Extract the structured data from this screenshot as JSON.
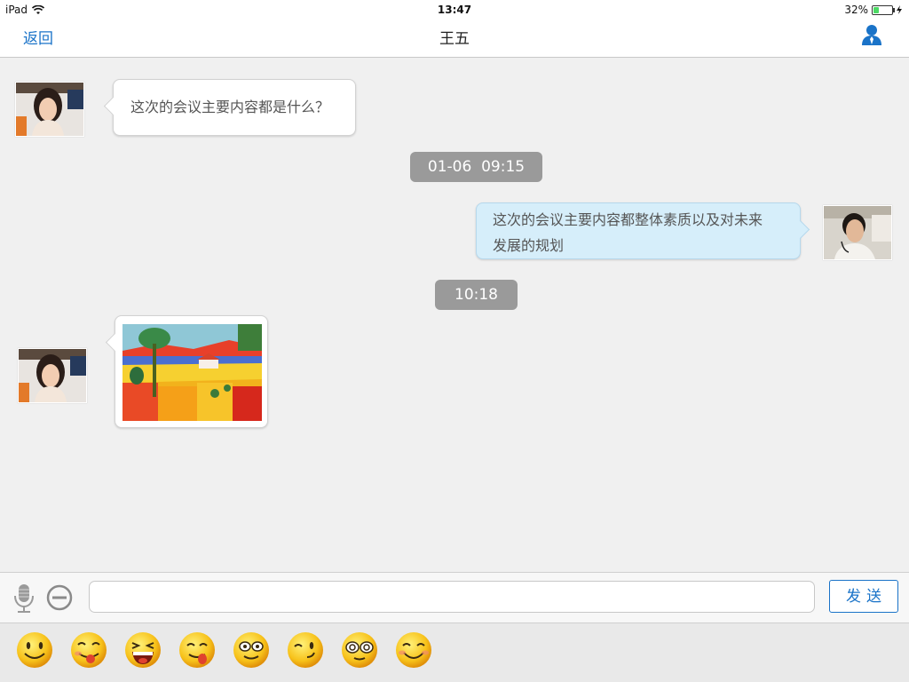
{
  "status_bar": {
    "device": "iPad",
    "time": "13:47",
    "battery": "32%",
    "battery_level": 0.32
  },
  "nav": {
    "back_label": "返回",
    "title": "王五",
    "profile_icon": "person-icon",
    "accent": "#1a73c8"
  },
  "chat": {
    "messages": [
      {
        "side": "left",
        "type": "text",
        "text": "这次的会议主要内容都是什么？"
      },
      {
        "type": "timestamp",
        "text": "01-06  09:15"
      },
      {
        "side": "right",
        "type": "text",
        "line1": "这次的会议主要内容都整体素质以及对未来",
        "line2": "发展的规划"
      },
      {
        "type": "timestamp",
        "text": "10:18"
      },
      {
        "side": "left",
        "type": "image",
        "image": "landscape-painting"
      }
    ]
  },
  "composer": {
    "placeholder": "",
    "value": "",
    "send_label": "发送"
  },
  "emoji_tray": {
    "items": [
      "smile-emoji",
      "tongue-emoji",
      "laughing-emoji",
      "yum-emoji",
      "surprised-emoji",
      "wink-emoji",
      "dizzy-eyes-emoji",
      "grin-emoji"
    ]
  }
}
